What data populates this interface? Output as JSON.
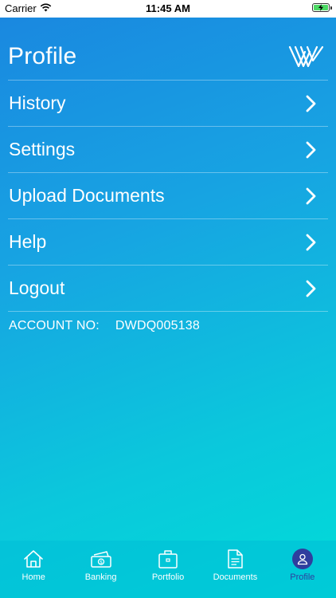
{
  "status_bar": {
    "carrier": "Carrier",
    "time": "11:45 AM",
    "icons": [
      "wifi-icon",
      "battery-charging-icon"
    ]
  },
  "header": {
    "title": "Profile",
    "logo_icon": "brand-w-logo"
  },
  "menu": {
    "items": [
      {
        "label": "History",
        "icon": "chevron-right-icon"
      },
      {
        "label": "Settings",
        "icon": "chevron-right-icon"
      },
      {
        "label": "Upload Documents",
        "icon": "chevron-right-icon"
      },
      {
        "label": "Help",
        "icon": "chevron-right-icon"
      },
      {
        "label": "Logout",
        "icon": "chevron-right-icon"
      }
    ]
  },
  "account": {
    "label": "ACCOUNT NO:",
    "number": "DWDQ005138"
  },
  "tab_bar": {
    "tabs": [
      {
        "label": "Home",
        "icon": "home-icon"
      },
      {
        "label": "Banking",
        "icon": "money-icon"
      },
      {
        "label": "Portfolio",
        "icon": "briefcase-icon"
      },
      {
        "label": "Documents",
        "icon": "document-icon"
      },
      {
        "label": "Profile",
        "icon": "user-icon"
      }
    ],
    "active": "Profile"
  },
  "colors": {
    "gradient_top": "#1a86e0",
    "gradient_bottom": "#00dcd8",
    "active_tab": "#2f3e9e",
    "text": "#ffffff"
  }
}
